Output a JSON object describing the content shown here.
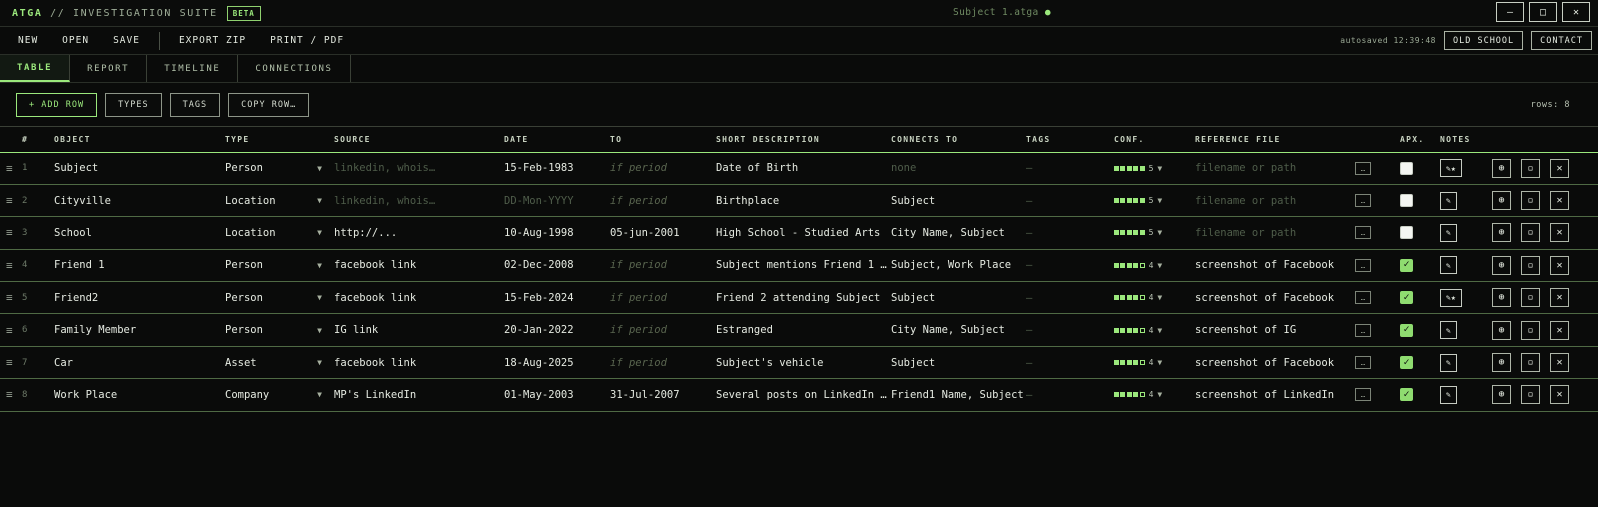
{
  "app": {
    "brand": "ATGA",
    "brand_sep": " // ",
    "brand_sub": "INVESTIGATION SUITE",
    "beta": "BETA",
    "filename": "Subject 1.atga",
    "modified_dot": "●",
    "window_controls": {
      "minimize": "—",
      "maximize": "□",
      "close": "✕"
    }
  },
  "menu": {
    "items": [
      "NEW",
      "OPEN",
      "SAVE",
      "EXPORT ZIP",
      "PRINT / PDF"
    ],
    "autosaved": "autosaved 12:39:48",
    "old_school": "OLD SCHOOL",
    "contact": "CONTACT"
  },
  "tabs": [
    {
      "label": "TABLE",
      "active": true
    },
    {
      "label": "REPORT"
    },
    {
      "label": "TIMELINE"
    },
    {
      "label": "CONNECTIONS"
    }
  ],
  "toolbar": {
    "add_row": "+ ADD ROW",
    "types": "TYPES",
    "tags": "TAGS",
    "copy_row": "COPY ROW…",
    "rows_count": "rows: 8"
  },
  "columns": [
    "#",
    "OBJECT",
    "TYPE",
    "SOURCE",
    "DATE",
    "TO",
    "SHORT DESCRIPTION",
    "CONNECTS TO",
    "TAGS",
    "CONF.",
    "REFERENCE FILE",
    "APX.",
    "NOTES"
  ],
  "rows": [
    {
      "n": "1",
      "object": "Subject",
      "type": "Person",
      "source": "linkedin, whois…",
      "source_ph": true,
      "date": "15-Feb-1983",
      "date_ph": false,
      "to": "if period",
      "to_ph": true,
      "desc": "Date of Birth",
      "connects": "none",
      "connects_ph": true,
      "tags": "–",
      "conf": 5,
      "ref": "filename or path",
      "ref_ph": true,
      "apx": false,
      "note": "✎★"
    },
    {
      "n": "2",
      "object": "Cityville",
      "type": "Location",
      "source": "linkedin, whois…",
      "source_ph": true,
      "date": "DD-Mon-YYYY",
      "date_ph": true,
      "to": "if period",
      "to_ph": true,
      "desc": "Birthplace",
      "connects": "Subject",
      "connects_ph": false,
      "tags": "–",
      "conf": 5,
      "ref": "filename or path",
      "ref_ph": true,
      "apx": false,
      "note": "✎"
    },
    {
      "n": "3",
      "object": "School",
      "type": "Location",
      "source": "http://...",
      "source_ph": false,
      "date": "10-Aug-1998",
      "date_ph": false,
      "to": "05-jun-2001",
      "to_ph": false,
      "desc": "High School - Studied Arts",
      "connects": "City Name, Subject",
      "connects_ph": false,
      "tags": "–",
      "conf": 5,
      "ref": "filename or path",
      "ref_ph": true,
      "apx": false,
      "note": "✎"
    },
    {
      "n": "4",
      "object": "Friend 1",
      "type": "Person",
      "source": "facebook link",
      "source_ph": false,
      "date": "02-Dec-2008",
      "date_ph": false,
      "to": "if period",
      "to_ph": true,
      "desc": "Subject mentions Friend 1 …",
      "connects": "Subject, Work Place",
      "connects_ph": false,
      "tags": "–",
      "conf": 4,
      "ref": "screenshot of Facebook",
      "ref_ph": false,
      "apx": true,
      "note": "✎"
    },
    {
      "n": "5",
      "object": "Friend2",
      "type": "Person",
      "source": "facebook link",
      "source_ph": false,
      "date": "15-Feb-2024",
      "date_ph": false,
      "to": "if period",
      "to_ph": true,
      "desc": "Friend 2 attending Subject",
      "connects": "Subject",
      "connects_ph": false,
      "tags": "–",
      "conf": 4,
      "ref": "screenshot of Facebook",
      "ref_ph": false,
      "apx": true,
      "note": "✎★"
    },
    {
      "n": "6",
      "object": "Family Member",
      "type": "Person",
      "source": "IG link",
      "source_ph": false,
      "date": "20-Jan-2022",
      "date_ph": false,
      "to": "if period",
      "to_ph": true,
      "desc": "Estranged",
      "connects": "City Name, Subject",
      "connects_ph": false,
      "tags": "–",
      "conf": 4,
      "ref": "screenshot of IG",
      "ref_ph": false,
      "apx": true,
      "note": "✎"
    },
    {
      "n": "7",
      "object": "Car",
      "type": "Asset",
      "source": "facebook link",
      "source_ph": false,
      "date": "18-Aug-2025",
      "date_ph": false,
      "to": "if period",
      "to_ph": true,
      "desc": "Subject's vehicle",
      "connects": "Subject",
      "connects_ph": false,
      "tags": "–",
      "conf": 4,
      "ref": "screenshot of Facebook",
      "ref_ph": false,
      "apx": true,
      "note": "✎"
    },
    {
      "n": "8",
      "object": "Work Place",
      "type": "Company",
      "source": "MP's LinkedIn",
      "source_ph": false,
      "date": "01-May-2003",
      "date_ph": false,
      "to": "31-Jul-2007",
      "to_ph": false,
      "desc": "Several posts on LinkedIn …",
      "connects": "Friend1 Name, Subject",
      "connects_ph": false,
      "tags": "–",
      "conf": 4,
      "ref": "screenshot of LinkedIn",
      "ref_ph": false,
      "apx": true,
      "note": "✎"
    }
  ],
  "row_actions": {
    "locate": "⊕",
    "copy": "▫",
    "delete": "✕",
    "menu": "…",
    "drag": "≡",
    "caret": "▼"
  },
  "conf_max": 5,
  "colors": {
    "accent": "#9be87c",
    "bg": "#0a0b0a"
  }
}
